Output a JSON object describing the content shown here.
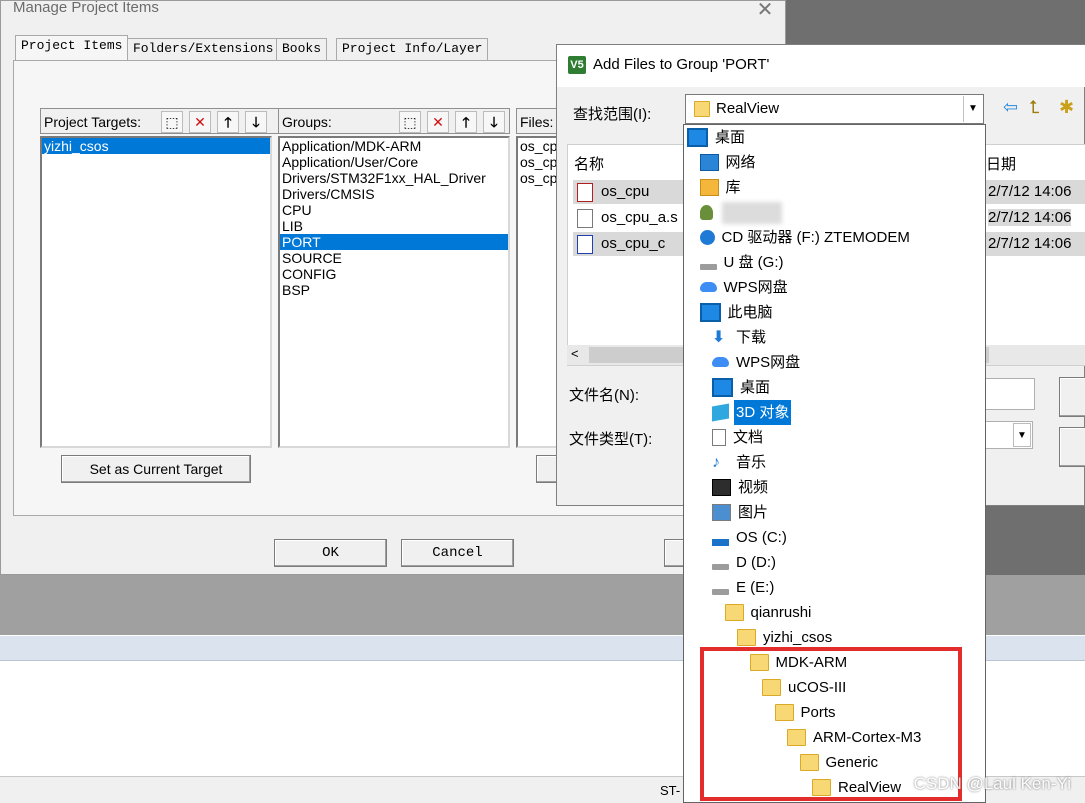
{
  "ide": {
    "status_text": "ST-",
    "watermark": "CSDN @Laul Ken-Yi"
  },
  "manage_dialog": {
    "title": "Manage Project Items",
    "close_glyph": "✕",
    "tabs": [
      "Project Items",
      "Folders/Extensions",
      "Books",
      "Project Info/Layer"
    ],
    "targets_label": "Project Targets:",
    "targets": [
      "yizhi_csos"
    ],
    "groups_label": "Groups:",
    "groups": [
      "Application/MDK-ARM",
      "Application/User/Core",
      "Drivers/STM32F1xx_HAL_Driver",
      "Drivers/CMSIS",
      "CPU",
      "LIB",
      "PORT",
      "SOURCE",
      "CONFIG",
      "BSP"
    ],
    "groups_selected_index": 6,
    "files_label": "Files:",
    "files": [
      "os_cpu",
      "os_cpu",
      "os_cpu"
    ],
    "set_target_button": "Set as Current Target",
    "ok_button": "OK",
    "cancel_button": "Cancel",
    "toolbar_icons": [
      "new-icon",
      "delete-icon",
      "move-up-icon",
      "move-down-icon"
    ]
  },
  "add_files_dialog": {
    "title": "Add Files to Group 'PORT'",
    "logo": "V5",
    "look_in_label": "查找范围(I):",
    "look_in_value": "RealView",
    "col_name": "名称",
    "col_date": "日期",
    "files": [
      {
        "name": "os_cpu",
        "date": "2/7/12 14:06",
        "icon": "header-file-icon"
      },
      {
        "name": "os_cpu_a.s",
        "date": "2/7/12 14:06",
        "icon": "asm-file-icon"
      },
      {
        "name": "os_cpu_c",
        "date": "2/7/12 14:06",
        "icon": "c-file-icon"
      }
    ],
    "filename_label": "文件名(N):",
    "filetype_label": "文件类型(T):",
    "scroll_left_glyph": "<"
  },
  "dropdown": {
    "items": [
      {
        "label": "桌面",
        "icon": "desktop-icon",
        "indent": 0
      },
      {
        "label": "网络",
        "icon": "network-icon",
        "indent": 1
      },
      {
        "label": "库",
        "icon": "library-icon",
        "indent": 1
      },
      {
        "label": "",
        "icon": "user-icon",
        "indent": 1
      },
      {
        "label": "CD 驱动器 (F:) ZTEMODEM",
        "icon": "cd-drive-icon",
        "indent": 1
      },
      {
        "label": "U 盘 (G:)",
        "icon": "usb-drive-icon",
        "indent": 1
      },
      {
        "label": "WPS网盘",
        "icon": "cloud-icon",
        "indent": 1
      },
      {
        "label": "此电脑",
        "icon": "computer-icon",
        "indent": 1
      },
      {
        "label": "下载",
        "icon": "download-icon",
        "indent": 2
      },
      {
        "label": "WPS网盘",
        "icon": "cloud-icon",
        "indent": 2
      },
      {
        "label": "桌面",
        "icon": "desktop-icon",
        "indent": 2
      },
      {
        "label": "3D 对象",
        "icon": "3d-objects-icon",
        "indent": 2,
        "selected": true
      },
      {
        "label": "文档",
        "icon": "document-icon",
        "indent": 2
      },
      {
        "label": "音乐",
        "icon": "music-icon",
        "indent": 2
      },
      {
        "label": "视频",
        "icon": "video-icon",
        "indent": 2
      },
      {
        "label": "图片",
        "icon": "pictures-icon",
        "indent": 2
      },
      {
        "label": "OS (C:)",
        "icon": "os-drive-icon",
        "indent": 2
      },
      {
        "label": "D (D:)",
        "icon": "drive-icon",
        "indent": 2
      },
      {
        "label": "E (E:)",
        "icon": "drive-icon",
        "indent": 2
      },
      {
        "label": "qianrushi",
        "icon": "folder-icon",
        "indent": 3
      },
      {
        "label": "yizhi_csos",
        "icon": "folder-icon",
        "indent": 4
      },
      {
        "label": "MDK-ARM",
        "icon": "folder-icon",
        "indent": 5
      },
      {
        "label": "uCOS-III",
        "icon": "folder-icon",
        "indent": 6
      },
      {
        "label": "Ports",
        "icon": "folder-icon",
        "indent": 7
      },
      {
        "label": "ARM-Cortex-M3",
        "icon": "folder-icon",
        "indent": 8
      },
      {
        "label": "Generic",
        "icon": "folder-icon",
        "indent": 9
      },
      {
        "label": "RealView",
        "icon": "folder-icon",
        "indent": 10
      }
    ]
  },
  "colors": {
    "selection": "#0078d7",
    "highlight_box": "#e32d2d"
  }
}
